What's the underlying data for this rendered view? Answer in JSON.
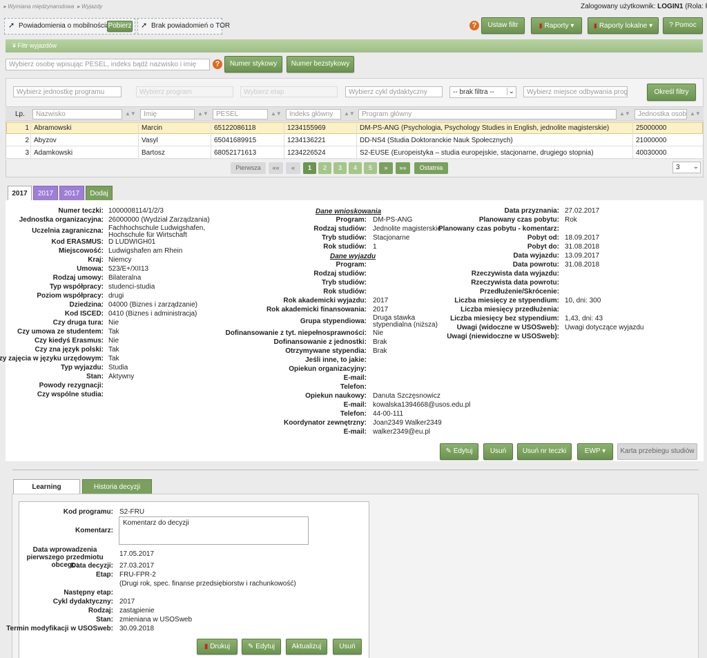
{
  "breadcrumb": [
    "Wymiana międzynarodowa",
    "Wyjazdy"
  ],
  "user": {
    "prefix": "Zalogowany użytkownik:",
    "login": "LOGIN1",
    "role": "(Rola: PEŁNA"
  },
  "top": {
    "notify_label": "Powiadomienia o mobilnościach",
    "download_label": "Pobierz",
    "tor_label": "Brak powiadomień o TOR",
    "set_filter": "Ustaw filtr",
    "reports": "Raporty",
    "local_reports": "Raporty lokalne",
    "help": "Pomoc"
  },
  "filter_bar": "Filtr wyjazdów",
  "search": {
    "person_placeholder": "Wybierz osobę wpisując PESEL, indeks bądź nazwisko i imię",
    "styk_button": "Numer stykowy",
    "bezstyk_button": "Numer bezstykowy"
  },
  "filters": {
    "unit_placeholder": "Wybierz jednostkę programu",
    "program_placeholder": "Wybierz program",
    "stage_placeholder": "Wybierz etap",
    "cycle_placeholder": "Wybierz cykl dydaktyczny",
    "no_filter": "-- brak filtra --",
    "place_placeholder": "Wybierz miejsce odbywania programu",
    "apply": "Określ filtry"
  },
  "table": {
    "lp": "Lp.",
    "headers": [
      "Nazwisko",
      "Imię",
      "PESEL",
      "Indeks główny",
      "Program główny",
      "Jednostka osoby"
    ],
    "rows": [
      [
        "1",
        "Abramowski",
        "Marcin",
        "65122086118",
        "1234155969",
        "DM-PS-ANG (Psychologia, Psychology Studies in English, jednolite magisterskie)",
        "25000000"
      ],
      [
        "2",
        "Abyzov",
        "Vasyl",
        "65041689915",
        "1234136221",
        "DD-NS4 (Studia Doktoranckie Nauk Społecznych)",
        "21000000"
      ],
      [
        "3",
        "Adamkowski",
        "Bartosz",
        "68052171613",
        "1234226524",
        "S2-EUSE (Europeistyka – studia europejskie, stacjonarne, drugiego stopnia)",
        "40030000"
      ]
    ]
  },
  "pager": {
    "first": "Pierwsza",
    "prev2": "««",
    "prev": "«",
    "pages": [
      "1",
      "2",
      "3",
      "4",
      "5"
    ],
    "next": "»",
    "next2": "»»",
    "last": "Ostatnia",
    "page_size": "3"
  },
  "year_tabs": [
    "2017",
    "2017",
    "2017",
    "Dodaj"
  ],
  "details": {
    "col1": [
      [
        "Numer teczki:",
        "1000008114/1/2/3"
      ],
      [
        "Jednostka organizacyjna:",
        "26000000 (Wydział Zarządzania)"
      ],
      [
        "Uczelnia zagraniczna:",
        "Fachhochschule Ludwigshafen, Hochschule für Wirtschaft"
      ],
      [
        "Kod ERASMUS:",
        "D  LUDWIGH01"
      ],
      [
        "Miejscowość:",
        "Ludwigshafen am Rhein"
      ],
      [
        "Kraj:",
        "Niemcy"
      ],
      [
        "Umowa:",
        "523/E+/XII13"
      ],
      [
        "Rodzaj umowy:",
        "Bilateralna"
      ],
      [
        "Typ współpracy:",
        "studenci-studia"
      ],
      [
        "Poziom współpracy:",
        "drugi"
      ],
      [
        "Dziedzina:",
        "04000 (Biznes i zarządzanie)"
      ],
      [
        "Kod ISCED:",
        "0410 (Biznes i administracja)"
      ],
      [
        "Czy druga tura:",
        "Nie"
      ],
      [
        "Czy umowa ze studentem:",
        "Tak"
      ],
      [
        "Czy kiedyś Erasmus:",
        "Nie"
      ],
      [
        "Czy zna język polski:",
        "Tak"
      ],
      [
        "Czy zajęcia w języku urzędowym:",
        "Tak"
      ],
      [
        "Typ wyjazdu:",
        "Studia"
      ],
      [
        "Stan:",
        "Aktywny"
      ],
      [
        "Powody rezygnacji:",
        ""
      ],
      [
        "Czy wspólne studia:",
        ""
      ]
    ],
    "col2_head1": "Dane wnioskowania",
    "col2_a": [
      [
        "Program:",
        "DM-PS-ANG"
      ],
      [
        "Rodzaj studiów:",
        "Jednolite magisterskie"
      ],
      [
        "Tryb studiów:",
        "Stacjonarne"
      ],
      [
        "Rok studiów:",
        "1"
      ]
    ],
    "col2_head2": "Dane wyjazdu",
    "col2_b": [
      [
        "Program:",
        ""
      ],
      [
        "Rodzaj studiów:",
        ""
      ],
      [
        "Tryb studiów:",
        ""
      ],
      [
        "Rok studiów:",
        ""
      ],
      [
        "Rok akademicki wyjazdu:",
        "2017"
      ],
      [
        "Rok akademicki finansowania:",
        "2017"
      ],
      [
        "Grupa stypendiowa:",
        "Druga stawka stypendialna (niższa)"
      ],
      [
        "Dofinansowanie z tyt. niepełnosprawności:",
        "Nie"
      ],
      [
        "Dofinansowanie z jednostki:",
        "Brak"
      ],
      [
        "Otrzymywane stypendia:",
        "Brak"
      ],
      [
        "Jeśli inne, to jakie:",
        ""
      ],
      [
        "Opiekun organizacyjny:",
        ""
      ],
      [
        "E-mail:",
        ""
      ],
      [
        "Telefon:",
        ""
      ],
      [
        "Opiekun naukowy:",
        "Danuta Szczęsnowicz"
      ],
      [
        "E-mail:",
        "kowalska1394668@usos.edu.pl"
      ],
      [
        "Telefon:",
        "44-00-111"
      ],
      [
        "Koordynator zewnętrzny:",
        "Joan2349 Walker2349"
      ],
      [
        "E-mail:",
        "walker2349@eu.pl"
      ]
    ],
    "col3": [
      [
        "Data przyznania:",
        "27.02.2017"
      ],
      [
        "Planowany czas pobytu:",
        "Rok"
      ],
      [
        "Planowany czas pobytu - komentarz:",
        ""
      ],
      [
        "Pobyt od:",
        "18.09.2017"
      ],
      [
        "Pobyt do:",
        "31.08.2018"
      ],
      [
        "Data wyjazdu:",
        "13.09.2017"
      ],
      [
        "Data powrotu:",
        "31.08.2018"
      ],
      [
        "Rzeczywista data wyjazdu:",
        ""
      ],
      [
        "Rzeczywista data powrotu:",
        ""
      ],
      [
        "Przedłużenie/Skrócenie:",
        ""
      ],
      [
        "Liczba miesięcy ze stypendium:",
        "10, dni: 300"
      ],
      [
        "Liczba miesięcy przedłużenia:",
        ""
      ],
      [
        "Liczba miesięcy bez stypendium:",
        "1,43, dni: 43"
      ],
      [
        "Uwagi (widoczne w USOSweb):",
        "Uwagi dotyczące wyjazdu"
      ],
      [
        "Uwagi (niewidoczne w USOSweb):",
        ""
      ]
    ],
    "actions": {
      "edit": "Edytuj",
      "delete": "Usuń",
      "delete_nr": "Usuń nr teczki",
      "ewp": "EWP",
      "card": "Karta przebiegu studiów"
    }
  },
  "lower_tabs": [
    "Learning Agreement",
    "Historia decyzji (EWP)"
  ],
  "agreement": {
    "rows_top": [
      [
        "Kod programu:",
        "S2-FRU"
      ]
    ],
    "comment_label": "Komentarz:",
    "comment_value": "Komentarz do decyzji",
    "first_subject_label": "Data wprowadzenia pierwszego przedmiotu obcego:",
    "first_subject_value": "17.05.2017",
    "rows": [
      [
        "Data decyzji:",
        "27.03.2017"
      ],
      [
        "Etap:",
        "FRU-FPR-2"
      ],
      [
        "",
        "(Drugi rok, spec. finanse przedsiębiorstw i rachunkowość)"
      ],
      [
        "Następny etap:",
        ""
      ],
      [
        "Cykl dydaktyczny:",
        "2017"
      ],
      [
        "Rodzaj:",
        "zastąpienie"
      ],
      [
        "Stan:",
        "zmieniana w USOSweb"
      ],
      [
        "Termin modyfikacji w USOSweb:",
        "30.09.2018"
      ]
    ],
    "buttons": {
      "print": "Drukuj",
      "edit": "Edytuj",
      "update": "Aktualizuj",
      "delete": "Usuń"
    }
  },
  "colors": {
    "accent_green": "#7aa05e",
    "tab_purple": "#9d7fd6",
    "highlight_row": "#faf1c8",
    "help_orange": "#e06a1c"
  }
}
